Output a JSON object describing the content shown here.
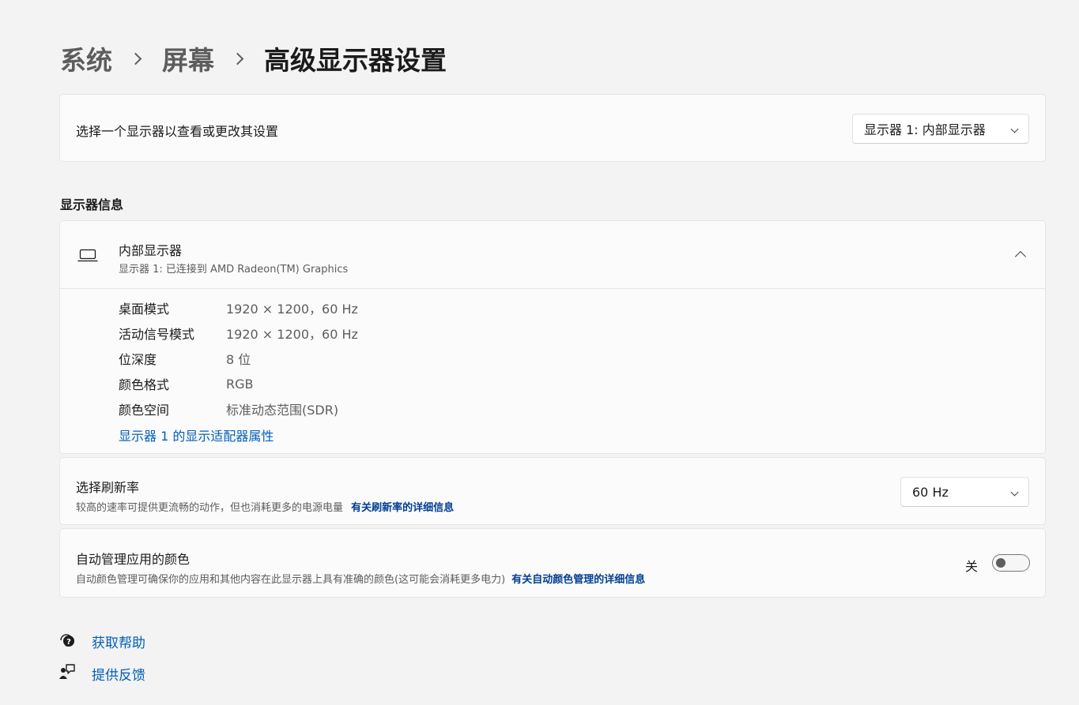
{
  "breadcrumb": {
    "system": "系统",
    "display": "屏幕",
    "current": "高级显示器设置"
  },
  "select_display": {
    "label": "选择一个显示器以查看或更改其设置",
    "value": "显示器 1: 内部显示器"
  },
  "display_info": {
    "section_title": "显示器信息",
    "name": "内部显示器",
    "subtitle": "显示器 1: 已连接到 AMD Radeon(TM) Graphics",
    "rows": [
      {
        "label": "桌面模式",
        "value": "1920 × 1200，60 Hz"
      },
      {
        "label": "活动信号模式",
        "value": "1920 × 1200，60 Hz"
      },
      {
        "label": "位深度",
        "value": "8 位"
      },
      {
        "label": "颜色格式",
        "value": "RGB"
      },
      {
        "label": "颜色空间",
        "value": "标准动态范围(SDR)"
      }
    ],
    "adapter_link": "显示器 1 的显示适配器属性"
  },
  "refresh_rate": {
    "title": "选择刷新率",
    "description": "较高的速率可提供更流畅的动作，但也消耗更多的电源电量",
    "link": "有关刷新率的详细信息",
    "value": "60 Hz"
  },
  "auto_color": {
    "title": "自动管理应用的颜色",
    "description": "自动颜色管理可确保你的应用和其他内容在此显示器上具有准确的颜色(这可能会消耗更多电力)",
    "link": "有关自动颜色管理的详细信息",
    "toggle_label": "关",
    "toggle_on": false
  },
  "footer": {
    "help": "获取帮助",
    "feedback": "提供反馈"
  },
  "icons": {
    "laptop": "laptop-icon",
    "help": "help-icon",
    "feedback": "feedback-icon"
  }
}
